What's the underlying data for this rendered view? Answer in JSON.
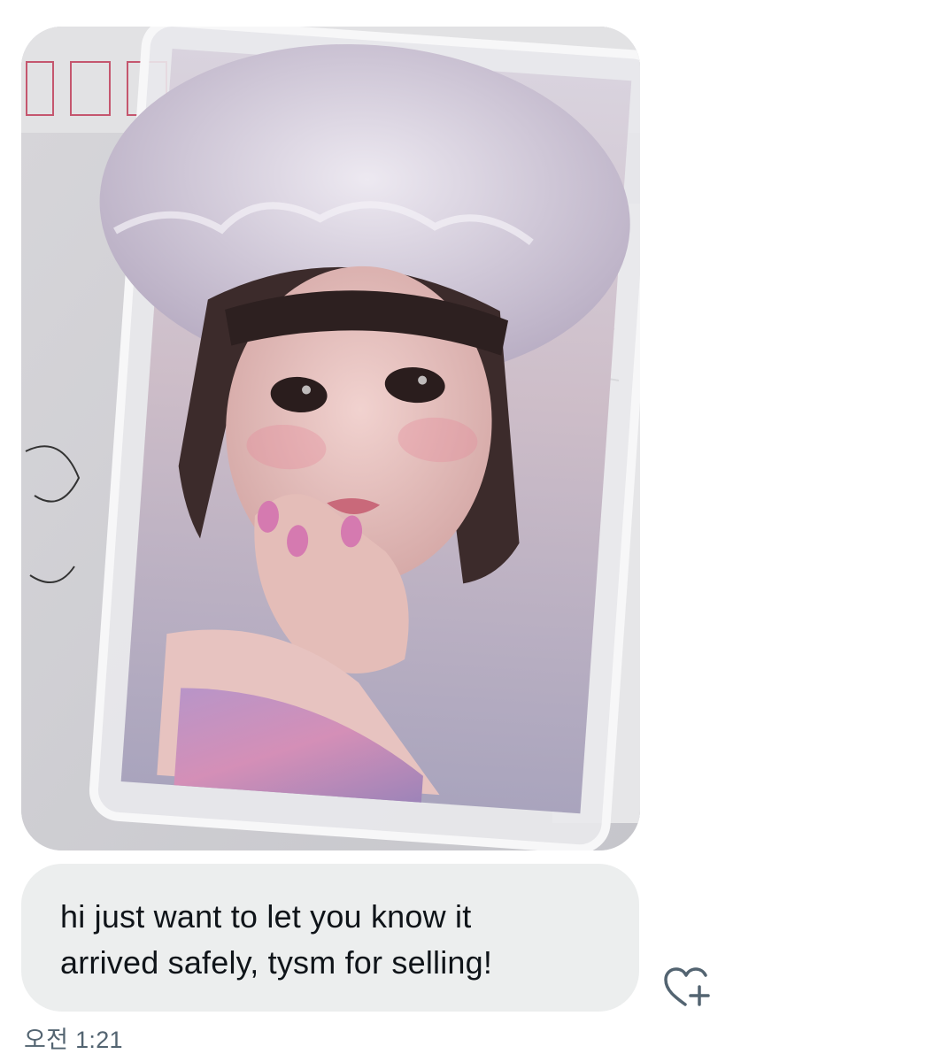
{
  "conversation": {
    "photo_message": {
      "alt": "photo of a photocard in a clear toploader",
      "icon": "photo-image"
    },
    "text_message": {
      "text": "hi just want to let you know it\narrived safely, tysm for selling!"
    },
    "react_button": {
      "icon": "heart-plus-icon"
    },
    "timestamp": "오전 1:21"
  },
  "colors": {
    "bubble_background": "#eceeee",
    "message_text": "#0f1419",
    "timestamp_text": "#536471",
    "icon_stroke": "#536471"
  }
}
